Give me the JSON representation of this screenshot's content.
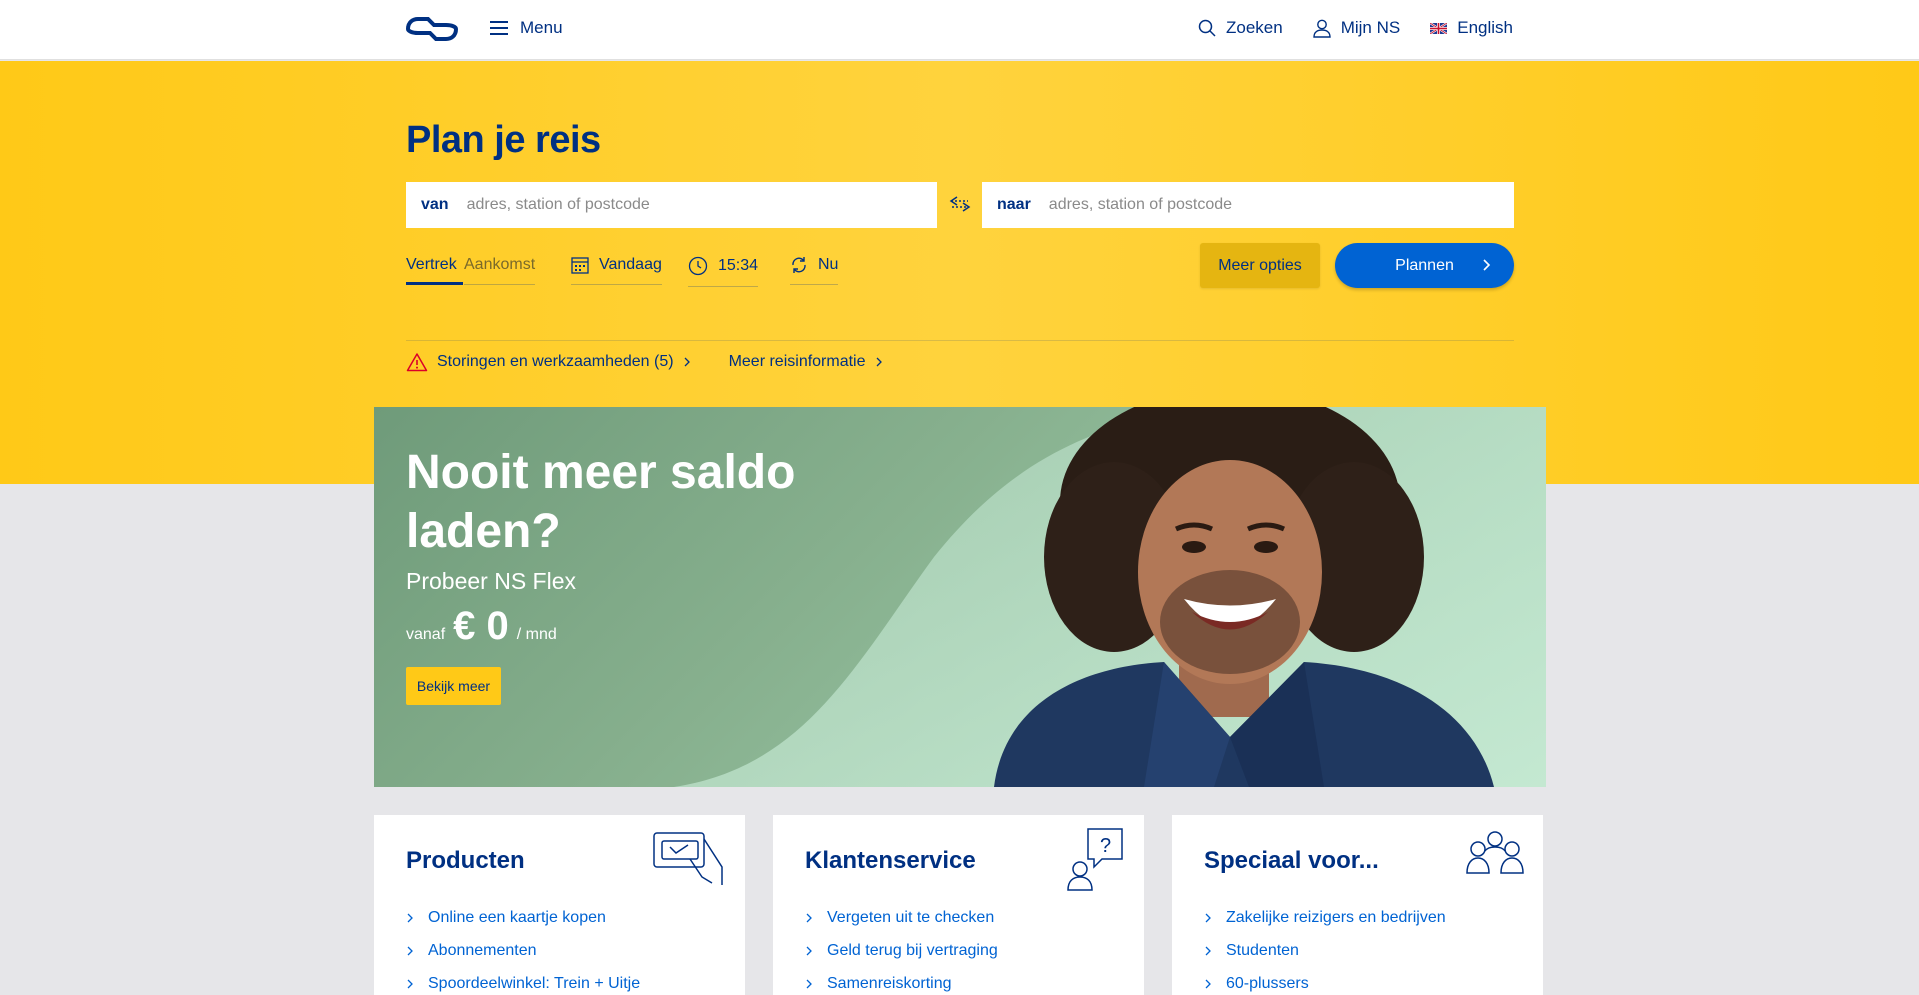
{
  "header": {
    "logo_name": "ns-logo",
    "menu_label": "Menu",
    "nav": [
      {
        "label": "Zoeken",
        "icon": "search-icon"
      },
      {
        "label": "Mijn NS",
        "icon": "user-icon"
      },
      {
        "label": "English",
        "icon": "uk-flag-icon"
      }
    ]
  },
  "planner": {
    "title": "Plan je reis",
    "from_label": "van",
    "from_placeholder": "adres, station of postcode",
    "to_label": "naar",
    "to_placeholder": "adres, station of postcode",
    "options": {
      "vertrek": "Vertrek",
      "aankomst": "Aankomst",
      "date": "Vandaag",
      "time": "15:34",
      "now": "Nu"
    },
    "meer_opties": "Meer opties",
    "plannen": "Plannen",
    "links": {
      "storingen": "Storingen en werkzaamheden (5)",
      "reisinfo": "Meer reisinformatie"
    }
  },
  "hero": {
    "title": "Nooit meer saldo laden?",
    "subtitle": "Probeer NS Flex",
    "price_from": "vanaf",
    "price_amount": "€ 0",
    "price_unit": "/ mnd",
    "button": "Bekijk meer"
  },
  "cards": [
    {
      "title": "Producten",
      "icon": "card-payment-icon",
      "links": [
        "Online een kaartje kopen",
        "Abonnementen",
        "Spoordeelwinkel: Trein + Uitje"
      ]
    },
    {
      "title": "Klantenservice",
      "icon": "customer-service-icon",
      "links": [
        "Vergeten uit te checken",
        "Geld terug bij vertraging",
        "Samenreiskorting"
      ]
    },
    {
      "title": "Speciaal voor...",
      "icon": "group-icon",
      "links": [
        "Zakelijke reizigers en bedrijven",
        "Studenten",
        "60-plussers"
      ]
    }
  ],
  "colors": {
    "ns_blue": "#003082",
    "ns_yellow": "#ffc917",
    "link_blue": "#0063d3",
    "alert_red": "#db0029"
  }
}
